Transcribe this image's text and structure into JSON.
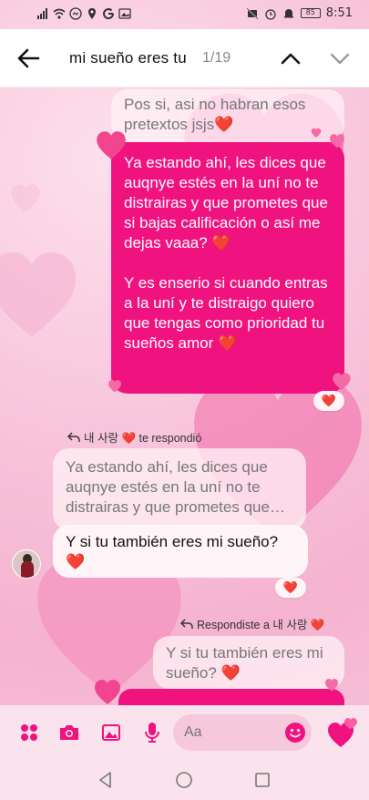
{
  "status_bar": {
    "time": "8:51",
    "battery": "85"
  },
  "search": {
    "query": "mi sueño eres tu",
    "counter": "1/19"
  },
  "messages": {
    "quoted_top": "Pos si, asi no habran esos pretextos jsjs❤️",
    "outgoing_main_p1": "Ya estando ahí, les dices que auqnye estés en la uní no te distrairas y que prometes que si bajas calificación o así me dejas vaaa? ❤️",
    "outgoing_main_p2": "Y es enserio si cuando entras a la uní y te distraigo quiero que tengas como prioridad tu sueños amor ❤️",
    "reaction_1": "❤️",
    "reply_label_1": "내 사랑 ❤️ te respondió",
    "incoming_quote": "Ya estando ahí, les dices que auqnye estés en la uní no te distrairas y que prometes que…",
    "incoming_reply": "Y si tu también eres mi sueño? ❤️",
    "reaction_2": "❤️",
    "reply_label_2": "Respondiste a 내 사랑 ❤️",
    "outgoing_quote": "Y si tu también eres mi sueño? ❤️"
  },
  "composer": {
    "placeholder": "Aa"
  },
  "colors": {
    "accent": "#f0127f",
    "header_bg": "#ffffff",
    "bubble_incoming": "#fff5f8",
    "heart_red": "#e0112b"
  },
  "icons": [
    "back-arrow-icon",
    "chevron-up-icon",
    "chevron-down-icon",
    "apps-icon",
    "camera-icon",
    "gallery-icon",
    "microphone-icon",
    "emoji-icon",
    "heart-sticker-icon",
    "nav-back-icon",
    "nav-home-icon",
    "nav-recents-icon"
  ]
}
